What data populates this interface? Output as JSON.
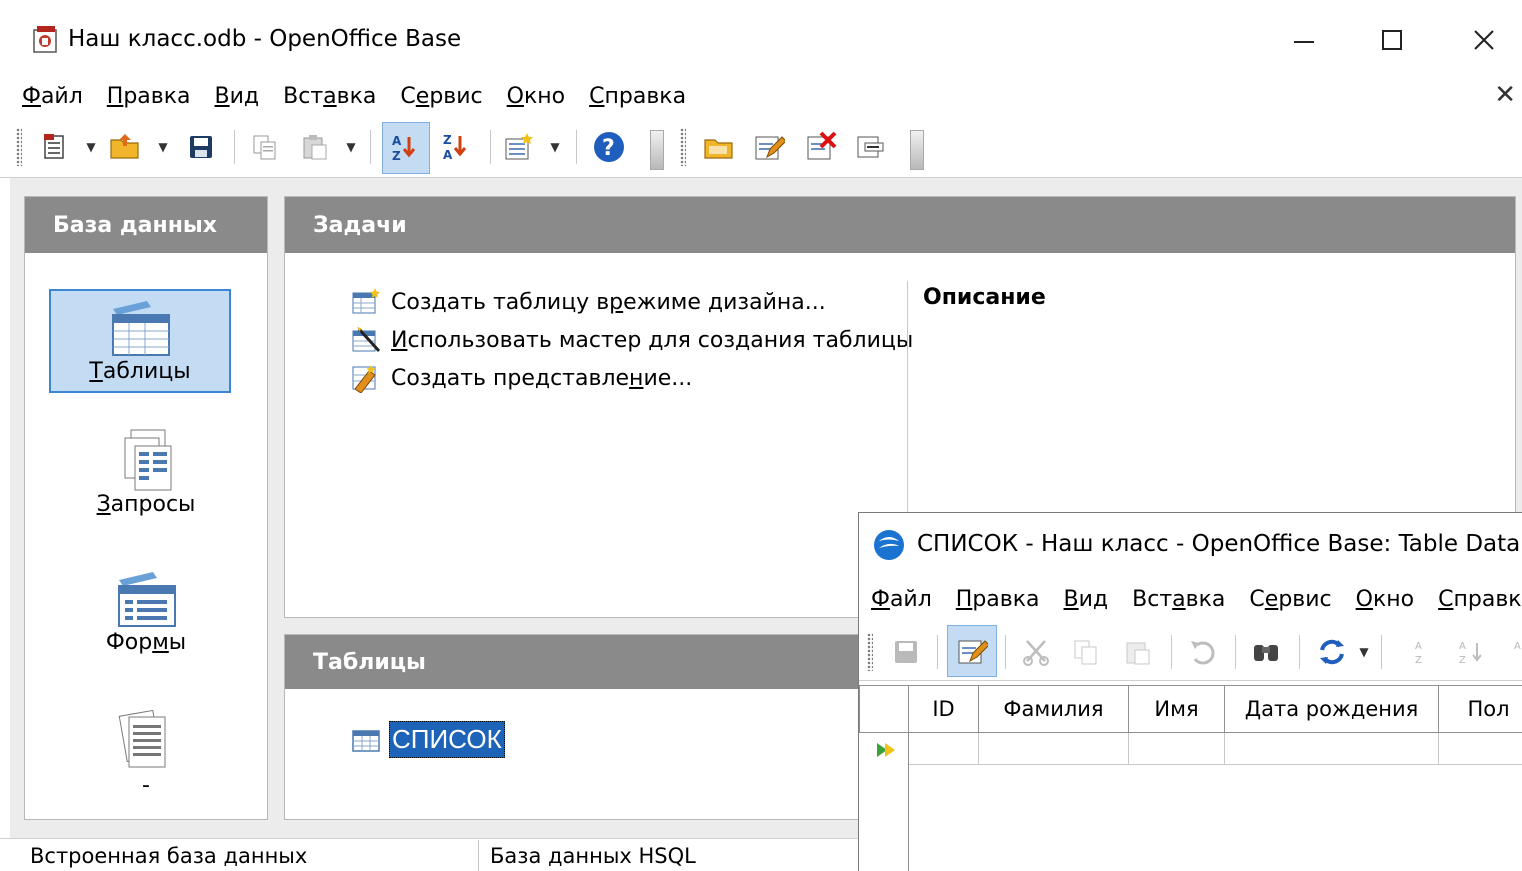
{
  "window": {
    "title": "Наш класс.odb - OpenOffice Base",
    "minimize": "—",
    "maximize": "☐",
    "close": "✕",
    "doc_close": "✕"
  },
  "menu": {
    "items": [
      {
        "label": "Файл",
        "mnemonic": "Ф",
        "rest": "айл"
      },
      {
        "label": "Правка",
        "mnemonic": "П",
        "rest": "равка"
      },
      {
        "label": "Вид",
        "mnemonic": "В",
        "rest": "ид"
      },
      {
        "label": "Вставка",
        "pre": "Вст",
        "mnemonic": "а",
        "rest": "вка"
      },
      {
        "label": "Сервис",
        "pre": "С",
        "mnemonic": "е",
        "rest": "рвис"
      },
      {
        "label": "Окно",
        "mnemonic": "О",
        "rest": "кно"
      },
      {
        "label": "Справка",
        "mnemonic": "С",
        "rest": "правка"
      }
    ]
  },
  "toolbar": {
    "icons": [
      "new-document-icon",
      "open-folder-icon",
      "save-icon",
      "copy-icon",
      "paste-icon",
      "sort-ascending-icon",
      "sort-descending-icon",
      "form-design-icon",
      "help-icon",
      "open-database-object-icon",
      "edit-icon",
      "delete-icon",
      "rename-icon"
    ]
  },
  "database_panel": {
    "header": "База данных",
    "items": [
      {
        "label": "Таблицы",
        "mnemonic": "Т",
        "rest": "аблицы",
        "selected": true,
        "icon": "tables-icon"
      },
      {
        "label": "Запросы",
        "mnemonic": "З",
        "rest": "апросы",
        "selected": false,
        "icon": "queries-icon"
      },
      {
        "label": "Формы",
        "pre": "Фор",
        "mnemonic": "м",
        "rest": "ы",
        "selected": false,
        "icon": "forms-icon"
      },
      {
        "label": "-",
        "selected": false,
        "icon": "reports-icon"
      }
    ]
  },
  "tasks_panel": {
    "header": "Задачи",
    "tasks": [
      {
        "label": "Создать таблицу в режиме дизайна...",
        "pre": "Создать таблицу в ",
        "mnemonic": "р",
        "rest": "ежиме дизайна...",
        "icon": "design-table-icon"
      },
      {
        "label": "Использовать мастер для создания таблицы",
        "pre": "",
        "mnemonic": "И",
        "rest": "спользовать мастер для создания таблицы",
        "icon": "table-wizard-icon"
      },
      {
        "label": "Создать представление...",
        "pre": "Создать представле",
        "mnemonic": "н",
        "rest": "ие...",
        "icon": "create-view-icon"
      }
    ],
    "description_title": "Описание"
  },
  "tables_panel": {
    "header": "Таблицы",
    "tables": [
      {
        "name": "СПИСОК",
        "selected": true
      }
    ]
  },
  "status": {
    "left": "Встроенная база данных",
    "right": "База данных HSQL"
  },
  "data_window": {
    "title": "СПИСОК - Наш класс - OpenOffice Base: Table Data View",
    "menu": [
      "Файл",
      "Правка",
      "Вид",
      "Вставка",
      "Сервис",
      "Окно",
      "Справка"
    ],
    "columns": [
      "ID",
      "Фамилия",
      "Имя",
      "Дата рождения",
      "Пол"
    ]
  },
  "colors": {
    "panel_header": "#8a8a8a",
    "selection": "#c4dcf3",
    "selection_border": "#3c86d3",
    "table_highlight": "#1d63b8"
  }
}
